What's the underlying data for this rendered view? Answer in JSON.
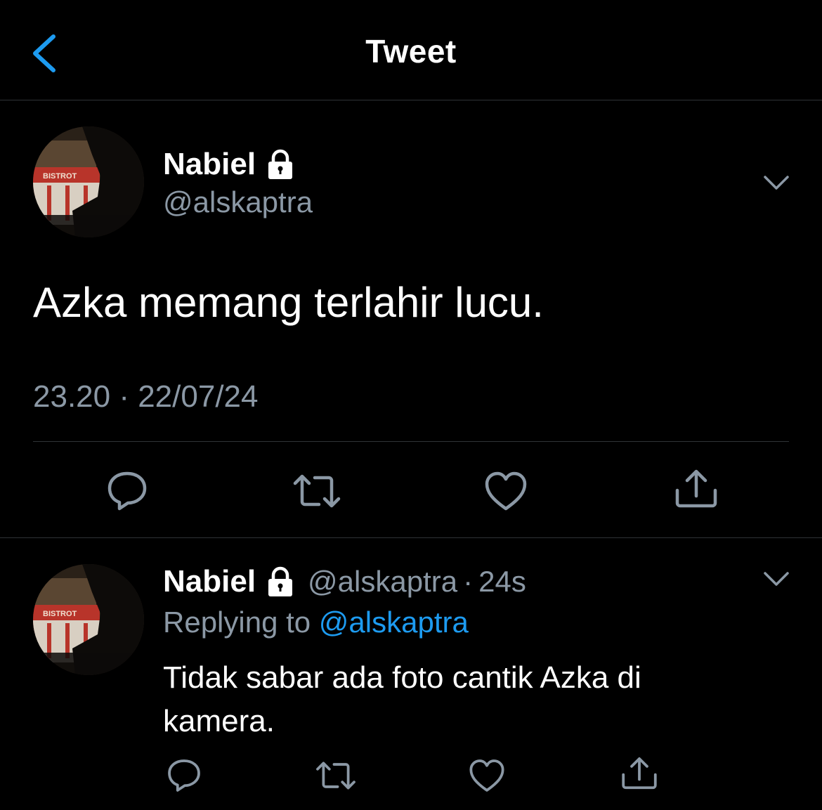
{
  "header": {
    "title": "Tweet",
    "back_icon": "chevron-left-icon",
    "accent_color": "#1d9bf0"
  },
  "main_tweet": {
    "author": {
      "display_name": "Nabiel",
      "handle": "@alskaptra",
      "protected": true,
      "avatar_sign_text": "BISTROT"
    },
    "text": "Azka memang terlahir lucu.",
    "timestamp": "23.20 · 22/07/24",
    "actions": [
      "reply-icon",
      "retweet-icon",
      "like-icon",
      "share-icon"
    ]
  },
  "reply_tweet": {
    "author": {
      "display_name": "Nabiel",
      "handle": "@alskaptra",
      "protected": true,
      "avatar_sign_text": "BISTROT"
    },
    "separator": "·",
    "time_ago": "24s",
    "replying_to_label": "Replying to",
    "replying_to_handle": "@alskaptra",
    "text": "Tidak sabar ada foto cantik Azka di kamera.",
    "actions": [
      "reply-icon",
      "retweet-icon",
      "like-icon",
      "share-icon"
    ]
  },
  "colors": {
    "background": "#000000",
    "text_primary": "#ffffff",
    "text_secondary": "#8b98a5",
    "divider": "#2f3336",
    "link": "#1d9bf0"
  }
}
